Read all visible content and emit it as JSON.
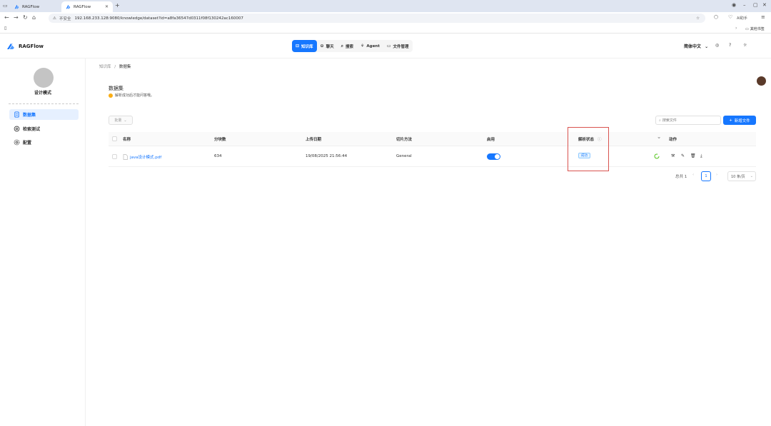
{
  "browser": {
    "tabs": [
      {
        "label": "RAGFlow",
        "active": false
      },
      {
        "label": "RAGFlow",
        "active": true
      }
    ],
    "security_label": "不安全",
    "url": "192.168.233.128:9080/knowledge/dataset?id=a8fa36547d0311f08f130242ac160007",
    "ai_button": "AI助手",
    "bookmarks_label": "其他书签"
  },
  "app": {
    "brand": "RAGFlow",
    "nav": [
      {
        "label": "知识库",
        "icon": "database-icon",
        "active": true
      },
      {
        "label": "聊天",
        "icon": "chat-icon",
        "active": false
      },
      {
        "label": "搜索",
        "icon": "search-icon",
        "active": false
      },
      {
        "label": "Agent",
        "icon": "agent-icon",
        "active": false
      },
      {
        "label": "文件管理",
        "icon": "folder-icon",
        "active": false
      }
    ],
    "language": "简体中文"
  },
  "sidebar": {
    "kb_name": "设计模式",
    "items": [
      {
        "label": "数据集",
        "icon": "file-icon",
        "active": true
      },
      {
        "label": "检索测试",
        "icon": "retrieval-icon",
        "active": false
      },
      {
        "label": "配置",
        "icon": "gear-icon",
        "active": false
      }
    ]
  },
  "main": {
    "breadcrumb": {
      "root": "知识库",
      "sep": "/",
      "current": "数据集"
    },
    "title": "数据集",
    "subtitle": "解析成功后才能问答哦。",
    "bulk_label": "批量",
    "search_placeholder": "搜索文件",
    "add_button": "新增文件",
    "columns": [
      "名称",
      "分块数",
      "上传日期",
      "切片方法",
      "启用",
      "解析状态",
      "动作"
    ],
    "rows": [
      {
        "name": "java设计模式.pdf",
        "chunks": "634",
        "upload_date": "19/08/2025 21:56:44",
        "method": "General",
        "enabled": true,
        "status": "成功"
      }
    ],
    "pagination": {
      "total": "总共 1",
      "current_page": "1",
      "page_size": "10 条/页"
    }
  },
  "colors": {
    "primary": "#1677ff",
    "highlight": "#d9534f"
  }
}
